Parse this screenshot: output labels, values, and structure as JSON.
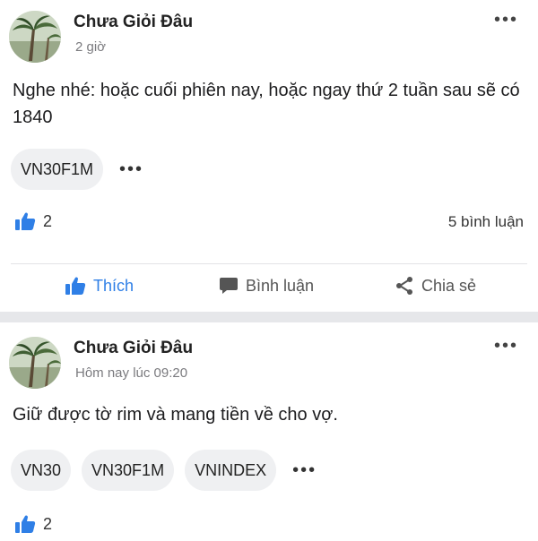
{
  "posts": [
    {
      "author": "Chưa Giỏi Đâu",
      "time": "2 giờ",
      "text": "Nghe nhé: hoặc cuối phiên nay, hoặc ngay thứ 2 tuần sau sẽ có 1840",
      "tags": [
        "VN30F1M"
      ],
      "likes": "2",
      "comments": "5 bình luận"
    },
    {
      "author": "Chưa Giỏi Đâu",
      "time": "Hôm nay lúc 09:20",
      "text": "Giữ được tờ rim và mang tiền về cho vợ.",
      "tags": [
        "VN30",
        "VN30F1M",
        "VNINDEX"
      ],
      "likes": "2"
    }
  ],
  "actions": {
    "like": "Thích",
    "comment": "Bình luận",
    "share": "Chia sẻ"
  },
  "more_glyph": "•••",
  "colors": {
    "accent": "#2f7fe6",
    "tag_bg": "#eff0f2",
    "divider": "#e6e7ea",
    "muted": "#7a7a7e"
  }
}
